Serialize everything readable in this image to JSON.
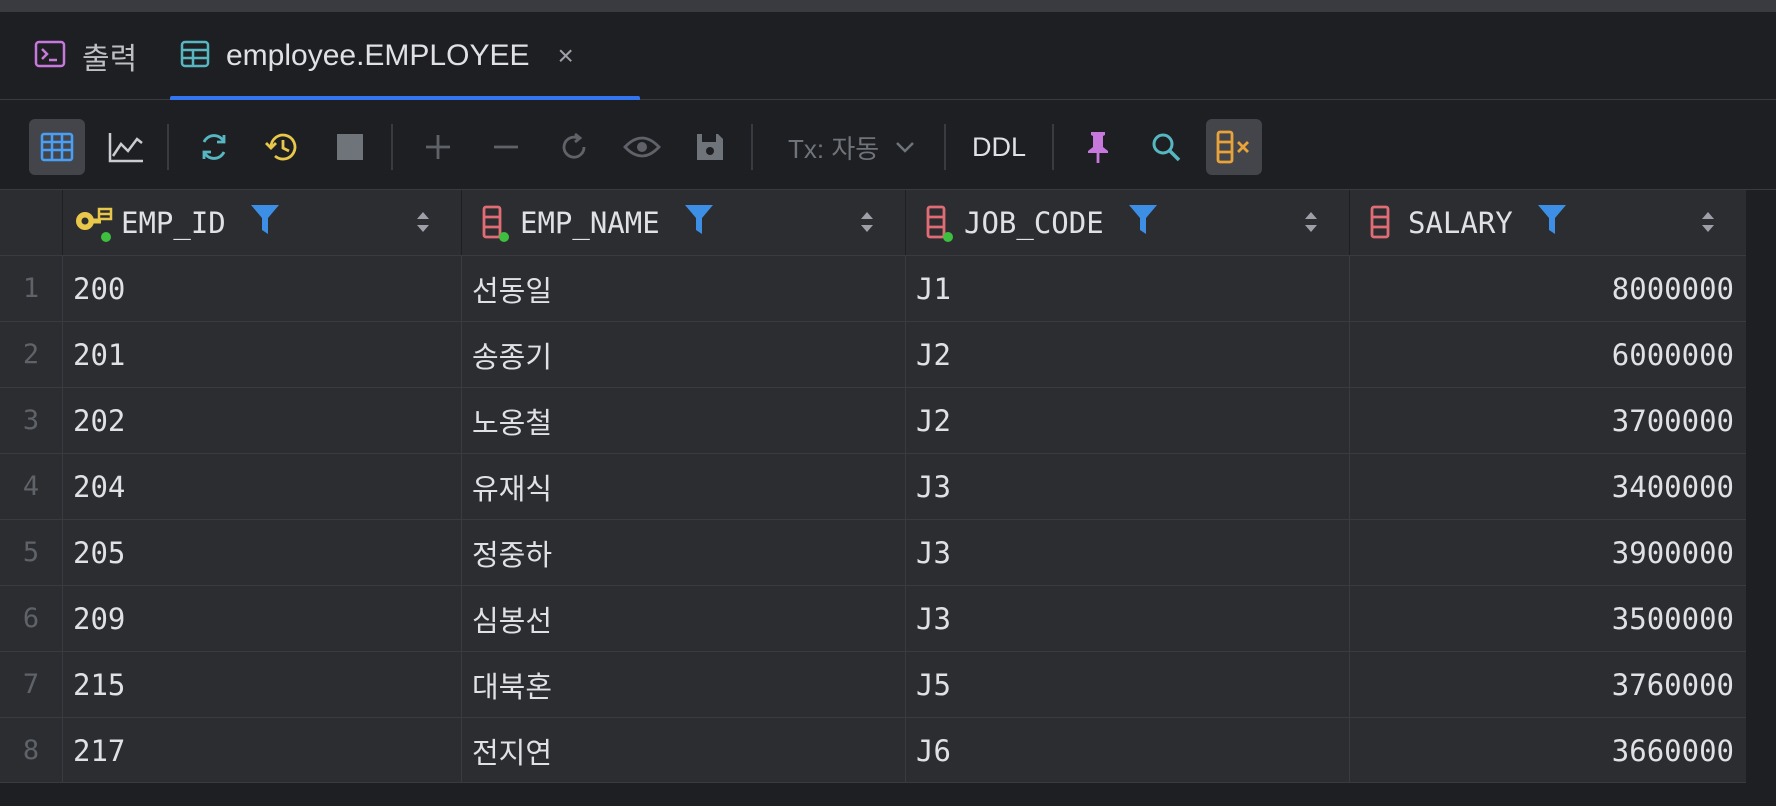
{
  "tabs": [
    {
      "label": "출력",
      "icon": "console-icon"
    },
    {
      "label": "employee.EMPLOYEE",
      "icon": "table-icon",
      "active": true,
      "close": "×"
    }
  ],
  "toolbar": {
    "buttons": [
      "table-view-icon",
      "chart-icon",
      "refresh-icon",
      "history-icon",
      "stop-icon",
      "add-row-icon",
      "delete-row-icon",
      "revert-icon",
      "preview-icon",
      "save-icon",
      "pin-icon",
      "search-icon",
      "columns-clear-icon"
    ],
    "tx_label": "Tx: 자동",
    "ddl_label": "DDL"
  },
  "table": {
    "columns": [
      {
        "name": "EMP_ID",
        "icon": "primary-key-icon"
      },
      {
        "name": "EMP_NAME",
        "icon": "column-icon"
      },
      {
        "name": "JOB_CODE",
        "icon": "column-icon"
      },
      {
        "name": "SALARY",
        "icon": "column-icon"
      }
    ],
    "rows": [
      {
        "n": "1",
        "emp_id": "200",
        "emp_name": "선동일",
        "job_code": "J1",
        "salary": "8000000"
      },
      {
        "n": "2",
        "emp_id": "201",
        "emp_name": "송종기",
        "job_code": "J2",
        "salary": "6000000"
      },
      {
        "n": "3",
        "emp_id": "202",
        "emp_name": "노옹철",
        "job_code": "J2",
        "salary": "3700000"
      },
      {
        "n": "4",
        "emp_id": "204",
        "emp_name": "유재식",
        "job_code": "J3",
        "salary": "3400000"
      },
      {
        "n": "5",
        "emp_id": "205",
        "emp_name": "정중하",
        "job_code": "J3",
        "salary": "3900000"
      },
      {
        "n": "6",
        "emp_id": "209",
        "emp_name": "심봉선",
        "job_code": "J3",
        "salary": "3500000"
      },
      {
        "n": "7",
        "emp_id": "215",
        "emp_name": "대북혼",
        "job_code": "J5",
        "salary": "3760000"
      },
      {
        "n": "8",
        "emp_id": "217",
        "emp_name": "전지연",
        "job_code": "J6",
        "salary": "3660000"
      }
    ]
  },
  "colors": {
    "accent": "#3574f0",
    "filter": "#3d8fe6",
    "column_icon": "#e06c75",
    "key_icon": "#e8c74a"
  }
}
